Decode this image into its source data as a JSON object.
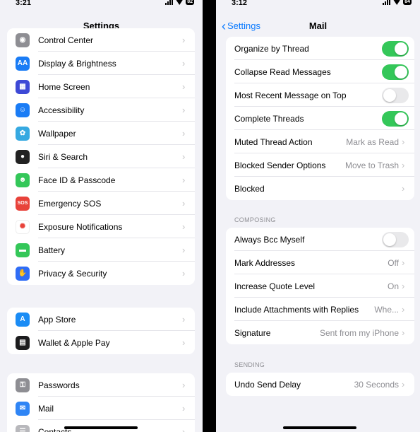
{
  "left": {
    "status": {
      "time": "3:21",
      "battery": "82"
    },
    "nav_title": "Settings",
    "group1": [
      {
        "label": "Control Center",
        "icon": "control-center-icon",
        "color": "#8e8e93"
      },
      {
        "label": "Display & Brightness",
        "icon": "display-brightness-icon",
        "color": "#1a7cf5"
      },
      {
        "label": "Home Screen",
        "icon": "home-screen-icon",
        "color": "#3d49d6"
      },
      {
        "label": "Accessibility",
        "icon": "accessibility-icon",
        "color": "#1a7cf5"
      },
      {
        "label": "Wallpaper",
        "icon": "wallpaper-icon",
        "color": "#36a9e1"
      },
      {
        "label": "Siri & Search",
        "icon": "siri-icon",
        "color": "#222222"
      },
      {
        "label": "Face ID & Passcode",
        "icon": "face-id-icon",
        "color": "#34c759"
      },
      {
        "label": "Emergency SOS",
        "icon": "sos-icon",
        "color": "#e8423a",
        "glyph": "SOS"
      },
      {
        "label": "Exposure Notifications",
        "icon": "exposure-icon",
        "color": "#ffffff"
      },
      {
        "label": "Battery",
        "icon": "battery-icon",
        "color": "#34c759"
      },
      {
        "label": "Privacy & Security",
        "icon": "privacy-hand-icon",
        "color": "#2f6df6"
      }
    ],
    "group2": [
      {
        "label": "App Store",
        "icon": "app-store-icon",
        "color": "#1a8cf5"
      },
      {
        "label": "Wallet & Apple Pay",
        "icon": "wallet-icon",
        "color": "#1c1c1e"
      }
    ],
    "group3": [
      {
        "label": "Passwords",
        "icon": "key-icon",
        "color": "#8e8e93"
      },
      {
        "label": "Mail",
        "icon": "mail-icon",
        "color": "#2f85f5"
      },
      {
        "label": "Contacts",
        "icon": "contacts-icon",
        "color": "#b8b8bc"
      }
    ]
  },
  "right": {
    "status": {
      "time": "3:12",
      "battery": "84"
    },
    "back_label": "Settings",
    "nav_title": "Mail",
    "threading": [
      {
        "label": "Organize by Thread",
        "toggle": true
      },
      {
        "label": "Collapse Read Messages",
        "toggle": true
      },
      {
        "label": "Most Recent Message on Top",
        "toggle": false
      },
      {
        "label": "Complete Threads",
        "toggle": true
      },
      {
        "label": "Muted Thread Action",
        "value": "Mark as Read"
      },
      {
        "label": "Blocked Sender Options",
        "value": "Move to Trash"
      },
      {
        "label": "Blocked",
        "value": ""
      }
    ],
    "composing_header": "COMPOSING",
    "composing": [
      {
        "label": "Always Bcc Myself",
        "toggle": false
      },
      {
        "label": "Mark Addresses",
        "value": "Off"
      },
      {
        "label": "Increase Quote Level",
        "value": "On"
      },
      {
        "label": "Include Attachments with Replies",
        "value": "Whe..."
      },
      {
        "label": "Signature",
        "value": "Sent from my iPhone"
      }
    ],
    "sending_header": "SENDING",
    "sending": [
      {
        "label": "Undo Send Delay",
        "value": "30 Seconds"
      }
    ]
  },
  "colors": {
    "accent": "#0a7aff",
    "toggle_on": "#34c759",
    "background": "#f2f2f7"
  }
}
